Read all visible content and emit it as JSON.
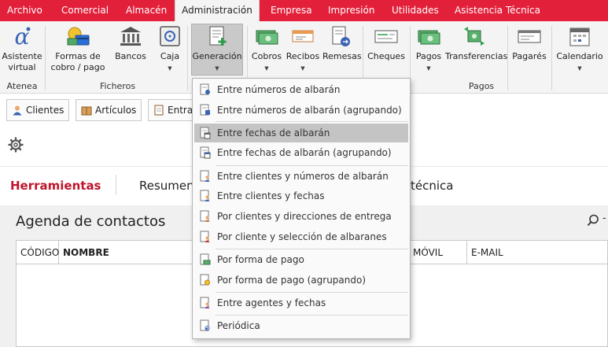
{
  "menu": {
    "items": [
      {
        "label": "Archivo"
      },
      {
        "label": "Comercial"
      },
      {
        "label": "Almacén"
      },
      {
        "label": "Administración"
      },
      {
        "label": "Empresa"
      },
      {
        "label": "Impresión"
      },
      {
        "label": "Utilidades"
      },
      {
        "label": "Asistencia Técnica"
      }
    ],
    "active_index": 3
  },
  "ribbon": {
    "buttons": [
      {
        "label_1": "Asistente",
        "label_2": "virtual"
      },
      {
        "label_1": "Formas de",
        "label_2": "cobro / pago"
      },
      {
        "label_1": "Bancos"
      },
      {
        "label_1": "Caja"
      },
      {
        "label_1": "Generación"
      },
      {
        "label_1": "Cobros"
      },
      {
        "label_1": "Recibos"
      },
      {
        "label_1": "Remesas"
      },
      {
        "label_1": "Cheques"
      },
      {
        "label_1": "Pagos"
      },
      {
        "label_1": "Transferencias"
      },
      {
        "label_1": "Pagarés"
      },
      {
        "label_1": "Calendario"
      }
    ],
    "groups": [
      "Atenea",
      "Ficheros",
      "Pagos"
    ]
  },
  "toolbar": {
    "clientes": "Clientes",
    "articulos": "Artículos",
    "entradas": "Entradas"
  },
  "section": {
    "title": "Herramientas",
    "tab_resumen": "Resumen",
    "tab_tecnica": "técnica"
  },
  "agenda": {
    "title": "Agenda de contactos",
    "dash": "-",
    "columns": [
      "CÓDIGO",
      "NOMBRE",
      "MÓVIL",
      "E-MAIL"
    ]
  },
  "dropdown": {
    "items": [
      {
        "label": "Entre números de albarán"
      },
      {
        "label": "Entre números de albarán (agrupando)"
      },
      {
        "label": "Entre fechas de albarán"
      },
      {
        "label": "Entre fechas de albarán (agrupando)"
      },
      {
        "label": "Entre clientes y números de albarán"
      },
      {
        "label": "Entre clientes y fechas"
      },
      {
        "label": "Por clientes y direcciones de entrega"
      },
      {
        "label": "Por cliente y selección de albaranes"
      },
      {
        "label": "Por forma de pago"
      },
      {
        "label": "Por forma de pago (agrupando)"
      },
      {
        "label": "Entre agentes y fechas"
      },
      {
        "label": "Periódica"
      }
    ],
    "highlighted_index": 2
  },
  "colors": {
    "accent": "#e3203a",
    "section_title": "#c0142c",
    "highlight": "#c4c4c4"
  }
}
